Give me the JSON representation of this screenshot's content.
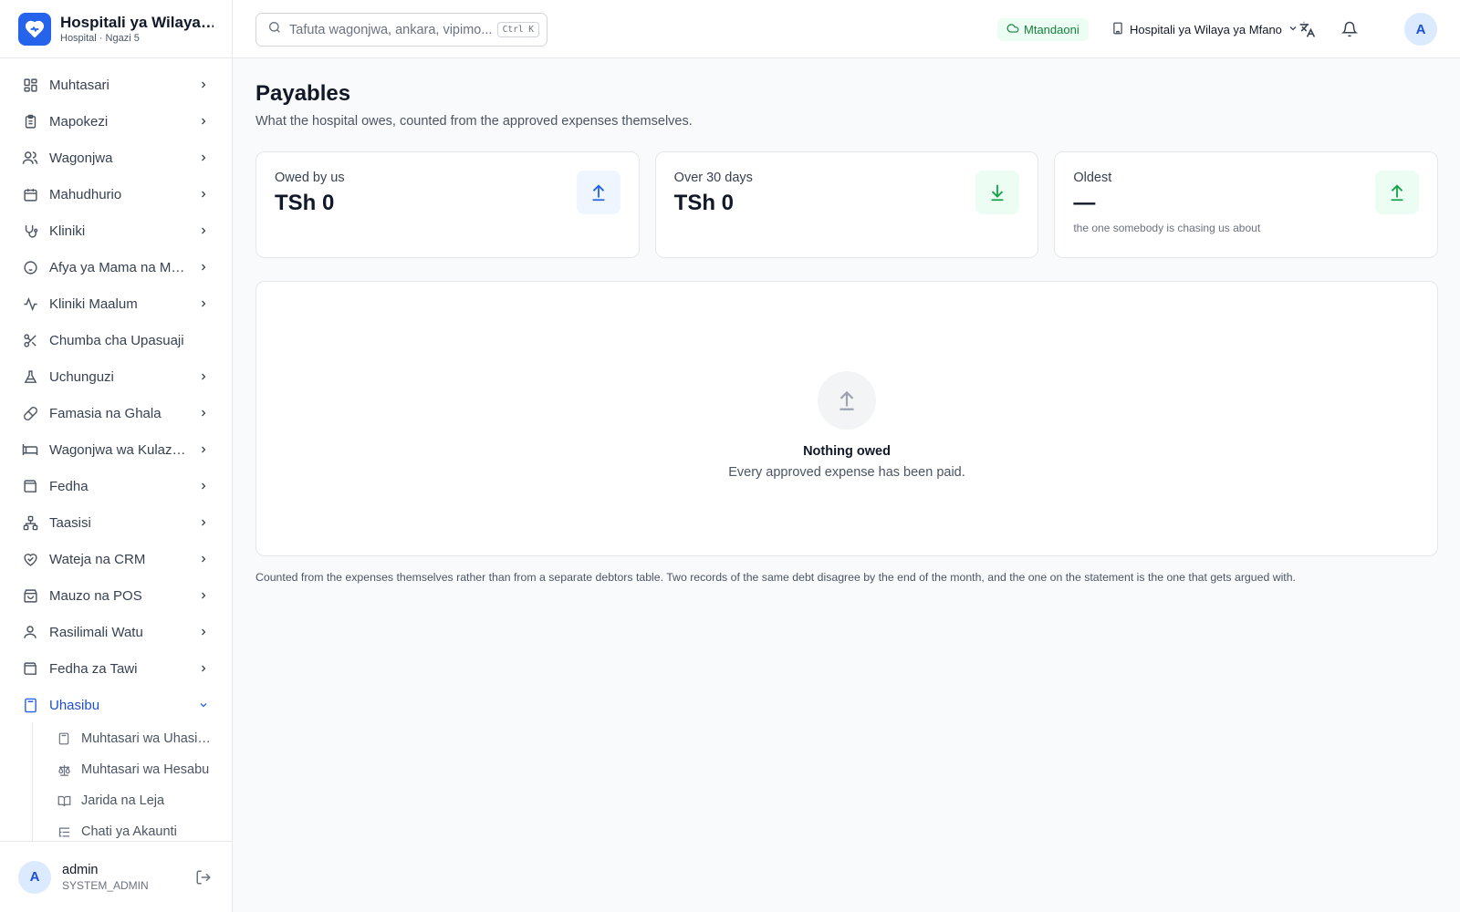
{
  "app": {
    "title": "Hospitali ya Wilaya ya Mfano",
    "subtitle": "Hospital · Ngazi 5"
  },
  "sidebar": {
    "items": [
      {
        "label": "Muhtasari",
        "icon": "grid-icon"
      },
      {
        "label": "Mapokezi",
        "icon": "clipboard-icon"
      },
      {
        "label": "Wagonjwa",
        "icon": "users-icon"
      },
      {
        "label": "Mahudhurio",
        "icon": "calendar-icon"
      },
      {
        "label": "Kliniki",
        "icon": "stethoscope-icon"
      },
      {
        "label": "Afya ya Mama na Mtoto",
        "icon": "baby-icon"
      },
      {
        "label": "Kliniki Maalum",
        "icon": "activity-icon"
      },
      {
        "label": "Chumba cha Upasuaji",
        "icon": "scissors-icon"
      },
      {
        "label": "Uchunguzi",
        "icon": "flask-icon"
      },
      {
        "label": "Famasia na Ghala",
        "icon": "pill-icon"
      },
      {
        "label": "Wagonjwa wa Kulazwa",
        "icon": "bed-icon"
      },
      {
        "label": "Fedha",
        "icon": "wallet-icon"
      },
      {
        "label": "Taasisi",
        "icon": "network-icon"
      },
      {
        "label": "Wateja na CRM",
        "icon": "handshake-icon"
      },
      {
        "label": "Mauzo na POS",
        "icon": "shopping-bag-icon"
      },
      {
        "label": "Rasilimali Watu",
        "icon": "user-icon"
      },
      {
        "label": "Fedha za Tawi",
        "icon": "wallet-icon"
      },
      {
        "label": "Uhasibu",
        "icon": "calculator-icon"
      }
    ],
    "sub_items": [
      {
        "label": "Muhtasari wa Uhasibu",
        "icon": "calculator-icon"
      },
      {
        "label": "Muhtasari wa Hesabu",
        "icon": "scale-icon"
      },
      {
        "label": "Jarida na Leja",
        "icon": "book-icon"
      },
      {
        "label": "Chati ya Akaunti",
        "icon": "list-tree-icon"
      }
    ]
  },
  "user": {
    "initial": "A",
    "name": "admin",
    "role": "SYSTEM_ADMIN"
  },
  "topbar": {
    "search_placeholder": "Tafuta wagonjwa, ankara, vipimo...",
    "shortcut": "Ctrl K",
    "status": "Mtandaoni",
    "facility": "Hospitali ya Wilaya ya Mfano",
    "avatar_initial": "A"
  },
  "page": {
    "title": "Payables",
    "subtitle": "What the hospital owes, counted from the approved expenses themselves.",
    "cards": [
      {
        "label": "Owed by us",
        "value": "TSh 0",
        "icon": "arrow-up-icon"
      },
      {
        "label": "Over 30 days",
        "value": "TSh 0",
        "icon": "arrow-down-icon"
      },
      {
        "label": "Oldest",
        "value": "—",
        "hint": "the one somebody is chasing us about",
        "icon": "arrow-up-icon"
      }
    ],
    "empty_title": "Nothing owed",
    "empty_text": "Every approved expense has been paid.",
    "footnote": "Counted from the expenses themselves rather than from a separate debtors table. Two records of the same debt disagree by the end of the month, and the one on the statement is the one that gets argued with."
  },
  "colors": {
    "accent": "#2563eb",
    "success": "#16a34a",
    "success_bg": "#ecfdf3",
    "accent_bg": "#eff6ff"
  }
}
